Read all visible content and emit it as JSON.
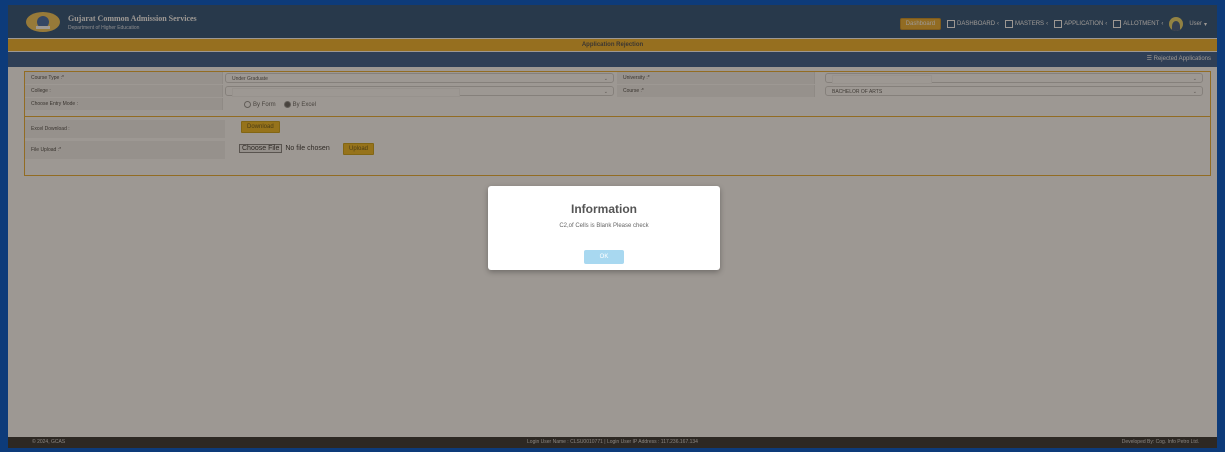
{
  "header": {
    "title": "Gujarat Common Admission Services",
    "subtitle": "Department of Higher Education",
    "nav": {
      "dashboard_button": "Dashboard",
      "items": [
        "DASHBOARD",
        "MASTERS",
        "APPLICATION",
        "ALLOTMENT"
      ],
      "user_label": "User"
    }
  },
  "page": {
    "title": "Application Rejection",
    "rejected_link": "Rejected Applications"
  },
  "form": {
    "course_type_label": "Course Type :*",
    "course_type_value": "Under Graduate",
    "university_label": "University :*",
    "college_label": "College :",
    "course_label": "Course :*",
    "course_value": "BACHELOR OF ARTS",
    "entry_mode_label": "Choose Entry Mode :",
    "entry_mode_options": [
      "By Form",
      "By Excel"
    ],
    "entry_mode_selected": "By Excel",
    "excel_download_label": "Excel Download :",
    "download_button": "Download",
    "file_upload_label": "File Upload :*",
    "choose_file_button": "Choose File",
    "no_file_text": "No file chosen",
    "upload_button": "Upload"
  },
  "modal": {
    "title": "Information",
    "message": "C2,of Cells is Blank Please check",
    "ok_button": "OK"
  },
  "footer": {
    "left": "© 2024, GCAS",
    "center": "Login User Name : CLSU0010771 | Login User IP Address : 117.236.167.134",
    "right": "Developed By: Cog. Info Petro Ltd."
  },
  "colors": {
    "header_bg": "#14406f",
    "accent_yellow": "#f0ad17",
    "sub_bar": "#234c84",
    "footer_bg": "#1f1f1f"
  }
}
